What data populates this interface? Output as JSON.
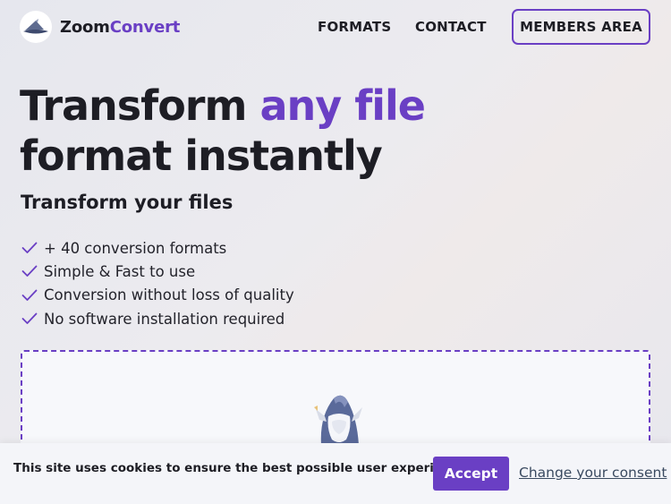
{
  "header": {
    "brand_part1": "Zoom",
    "brand_part2": "Convert",
    "nav": {
      "formats": "FORMATS",
      "contact": "CONTACT",
      "members": "MEMBERS AREA"
    }
  },
  "hero": {
    "title_before": "Transform ",
    "title_accent": "any file",
    "title_after": " format instantly",
    "subtitle": "Transform your files",
    "features": [
      "+ 40 conversion formats",
      "Simple & Fast to use",
      "Conversion without loss of quality",
      "No software installation required"
    ]
  },
  "cookie": {
    "message": "This site uses cookies to ensure the best possible user experience.",
    "accept": "Accept",
    "change": "Change your consent"
  },
  "colors": {
    "accent": "#6a3fc4",
    "text": "#1d1d24"
  },
  "icons": [
    "wizard-logo-icon",
    "check-icon",
    "wizard-mascot-icon"
  ]
}
